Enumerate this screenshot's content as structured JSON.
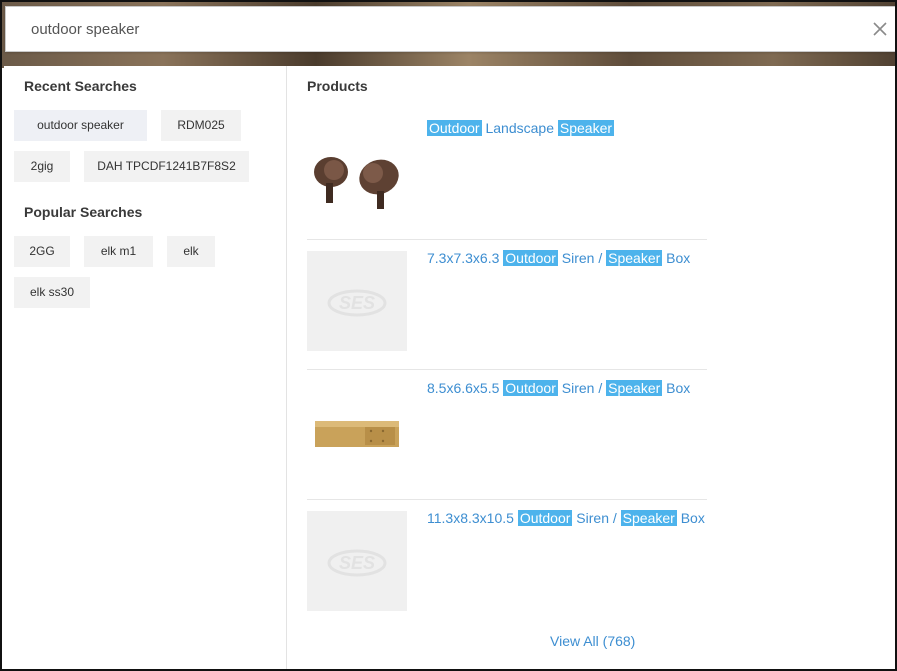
{
  "search": {
    "query": "outdoor speaker"
  },
  "recent": {
    "title": "Recent Searches",
    "items": [
      {
        "label": "outdoor  speaker"
      },
      {
        "label": "RDM025"
      },
      {
        "label": "2gig"
      },
      {
        "label": "DAH TPCDF1241B7F8S2"
      }
    ]
  },
  "popular": {
    "title": "Popular Searches",
    "items": [
      {
        "label": "2GG"
      },
      {
        "label": "elk m1"
      },
      {
        "label": "elk"
      },
      {
        "label": "elk ss30"
      }
    ]
  },
  "products": {
    "title": "Products",
    "items": [
      {
        "parts": [
          {
            "text": "Outdoor",
            "hl": true
          },
          {
            "text": " Landscape ",
            "hl": false
          },
          {
            "text": "Speaker",
            "hl": true
          }
        ],
        "image": "landscape-speaker-photo"
      },
      {
        "parts": [
          {
            "text": "7.3x7.3x6.3 ",
            "hl": false
          },
          {
            "text": "Outdoor",
            "hl": true
          },
          {
            "text": " Siren / ",
            "hl": false
          },
          {
            "text": "Speaker",
            "hl": true
          },
          {
            "text": " Box",
            "hl": false
          }
        ],
        "image": "placeholder-logo"
      },
      {
        "parts": [
          {
            "text": "8.5x6.6x5.5 ",
            "hl": false
          },
          {
            "text": "Outdoor",
            "hl": true
          },
          {
            "text": " Siren / ",
            "hl": false
          },
          {
            "text": "Speaker",
            "hl": true
          },
          {
            "text": " Box",
            "hl": false
          }
        ],
        "image": "brass-box-photo"
      },
      {
        "parts": [
          {
            "text": "11.3x8.3x10.5 ",
            "hl": false
          },
          {
            "text": "Outdoor",
            "hl": true
          },
          {
            "text": " Siren / ",
            "hl": false
          },
          {
            "text": "Speaker",
            "hl": true
          },
          {
            "text": " Box",
            "hl": false
          }
        ],
        "image": "placeholder-logo"
      }
    ],
    "view_all": "View All (768)"
  },
  "colors": {
    "accent": "#3d8ed1",
    "highlight": "#4db3ec",
    "chip": "#f2f2f2"
  },
  "icons": {
    "clear": "close-icon"
  }
}
